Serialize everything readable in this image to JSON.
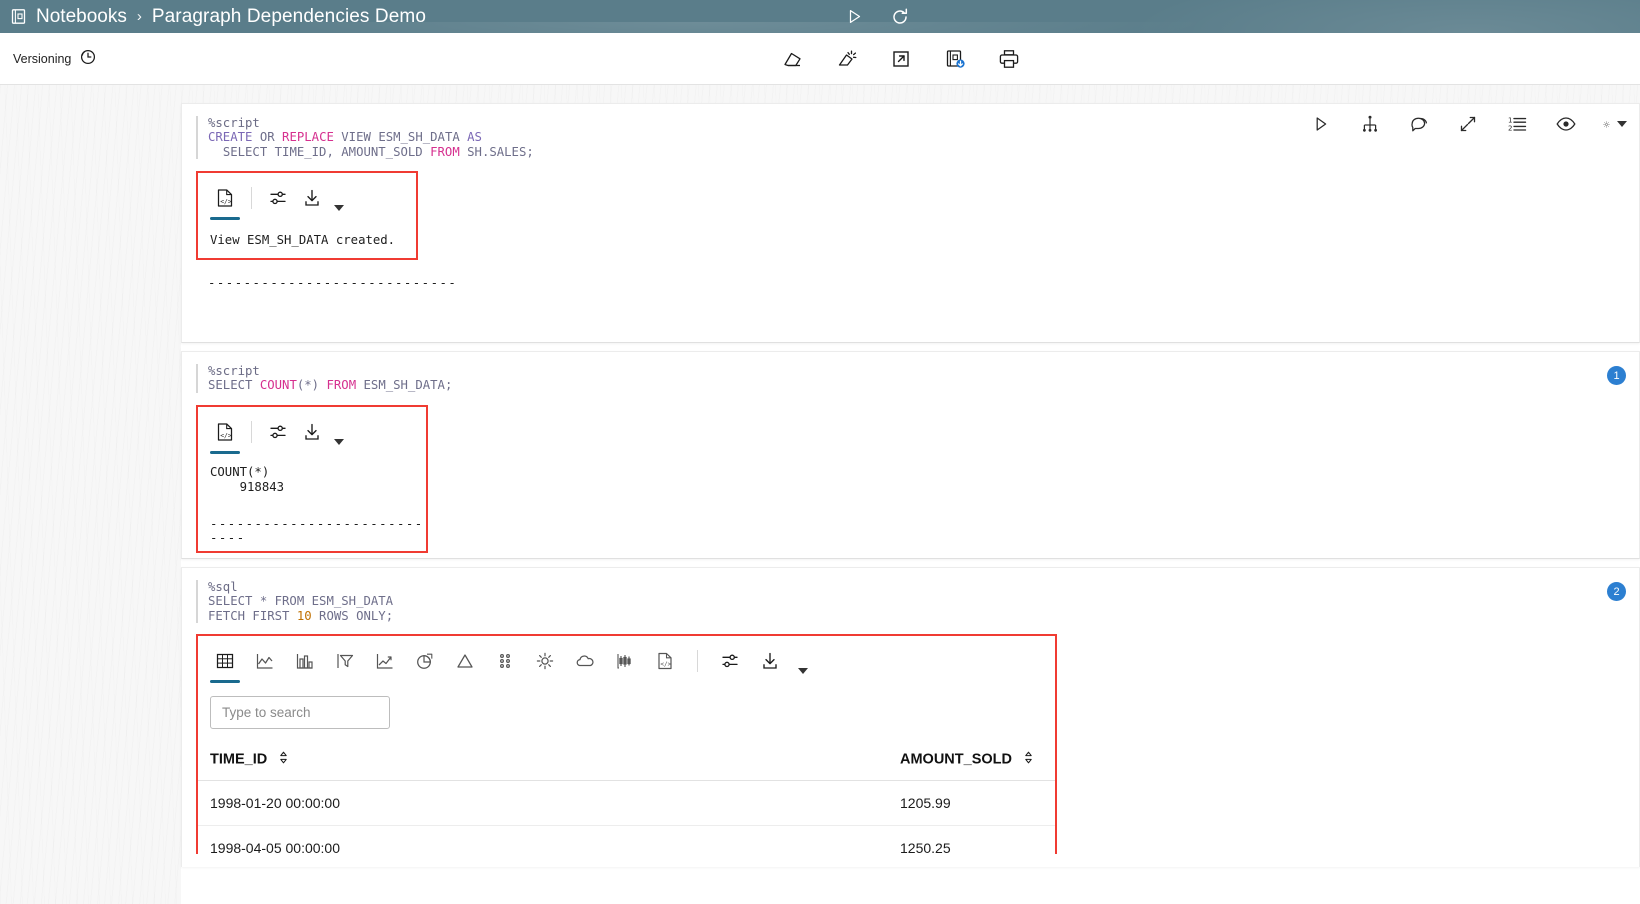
{
  "header": {
    "notebooks_label": "Notebooks",
    "separator": "›",
    "title": "Paragraph Dependencies Demo",
    "book_icon": "notebook-icon",
    "run_all_icon": "play-icon",
    "reset_icon": "refresh-icon"
  },
  "toolbar": {
    "versioning_label": "Versioning",
    "versioning_icon": "clock-history-icon",
    "actions": [
      {
        "name": "clear-results-icon",
        "title": "Clear Results"
      },
      {
        "name": "clear-all-output-icon",
        "title": "Clear All Output"
      },
      {
        "name": "external-link-icon",
        "title": "Open in New Window"
      },
      {
        "name": "save-notebook-icon",
        "title": "Save Notebook"
      },
      {
        "name": "print-icon",
        "title": "Print"
      }
    ]
  },
  "paragraph_actions": [
    {
      "name": "run-paragraph-icon",
      "title": "Run"
    },
    {
      "name": "dependency-graph-icon",
      "title": "Dependencies"
    },
    {
      "name": "comment-icon",
      "title": "Comment"
    },
    {
      "name": "expand-icon",
      "title": "Expand"
    },
    {
      "name": "line-numbers-icon",
      "title": "Line Numbers"
    },
    {
      "name": "visibility-icon",
      "title": "Show / Hide"
    },
    {
      "name": "settings-gear-icon",
      "title": "Settings"
    }
  ],
  "paragraphs": [
    {
      "id": "p1",
      "badge": "",
      "interpreter": "%script",
      "code_lines": [
        [
          {
            "t": "CREATE",
            "c": "kw-blue"
          },
          {
            "t": " OR ",
            "c": "kw-gray"
          },
          {
            "t": "REPLACE",
            "c": "kw-pink"
          },
          {
            "t": " VIEW ",
            "c": "kw-gray"
          },
          {
            "t": "ESM_SH_DATA",
            "c": "kw-gray"
          },
          {
            "t": " AS",
            "c": "kw-blue"
          }
        ],
        [
          {
            "t": "  SELECT",
            "c": "kw-gray"
          },
          {
            "t": " TIME_ID, AMOUNT_SOLD ",
            "c": "kw-gray"
          },
          {
            "t": "FROM",
            "c": "kw-pink"
          },
          {
            "t": " SH.SALES;",
            "c": "kw-gray"
          }
        ]
      ],
      "result_tabs": [
        {
          "name": "result-raw-tab",
          "icon": "code-document-icon",
          "active": true
        }
      ],
      "result_tools": [
        {
          "name": "result-settings-icon",
          "icon": "sliders-icon"
        },
        {
          "name": "result-download-icon",
          "icon": "download-icon"
        }
      ],
      "output_text": "View ESM_SH_DATA created.",
      "trailing_dashes": "----------------------------"
    },
    {
      "id": "p2",
      "badge": "1",
      "interpreter": "%script",
      "code_lines": [
        [
          {
            "t": "SELECT ",
            "c": "kw-gray"
          },
          {
            "t": "COUNT",
            "c": "kw-pink"
          },
          {
            "t": "(*) ",
            "c": "kw-gray"
          },
          {
            "t": "FROM",
            "c": "kw-pink"
          },
          {
            "t": " ESM_SH_DATA;",
            "c": "kw-gray"
          }
        ]
      ],
      "result_tabs": [
        {
          "name": "result-raw-tab",
          "icon": "code-document-icon",
          "active": true
        }
      ],
      "result_tools": [
        {
          "name": "result-settings-icon",
          "icon": "sliders-icon"
        },
        {
          "name": "result-download-icon",
          "icon": "download-icon"
        }
      ],
      "output_text": "COUNT(*)\n    918843",
      "trailing_dashes": "----------------------------"
    },
    {
      "id": "p3",
      "badge": "2",
      "interpreter": "%sql",
      "code_lines": [
        [
          {
            "t": "SELECT ",
            "c": "kw-gray"
          },
          {
            "t": "*",
            "c": "kw-gray"
          },
          {
            "t": " FROM ",
            "c": "kw-gray"
          },
          {
            "t": "ESM_SH_DATA",
            "c": "kw-gray"
          }
        ],
        [
          {
            "t": "FETCH FIRST ",
            "c": "kw-gray"
          },
          {
            "t": "10",
            "c": "kw-orange"
          },
          {
            "t": " ROWS ONLY;",
            "c": "kw-gray"
          }
        ]
      ],
      "chart_tabs": [
        {
          "name": "viz-table-tab",
          "icon": "table-grid-icon",
          "active": true
        },
        {
          "name": "viz-area-tab",
          "icon": "area-chart-icon",
          "active": false
        },
        {
          "name": "viz-bar-tab",
          "icon": "bar-chart-icon",
          "active": false
        },
        {
          "name": "viz-funnel-tab",
          "icon": "funnel-chart-icon",
          "active": false
        },
        {
          "name": "viz-line-tab",
          "icon": "line-trend-icon",
          "active": false
        },
        {
          "name": "viz-pie-tab",
          "icon": "pie-chart-icon",
          "active": false
        },
        {
          "name": "viz-pyramid-tab",
          "icon": "triangle-pyramid-icon",
          "active": false
        },
        {
          "name": "viz-scatter-tab",
          "icon": "scatter-dots-icon",
          "active": false
        },
        {
          "name": "viz-radial-tab",
          "icon": "sunburst-icon",
          "active": false
        },
        {
          "name": "viz-cloud-tab",
          "icon": "cloud-chart-icon",
          "active": false
        },
        {
          "name": "viz-candlestick-tab",
          "icon": "candlestick-icon",
          "active": false
        },
        {
          "name": "viz-raw-tab",
          "icon": "code-document-icon",
          "active": false
        }
      ],
      "result_tools": [
        {
          "name": "result-settings-icon",
          "icon": "sliders-icon"
        },
        {
          "name": "result-download-icon",
          "icon": "download-icon"
        }
      ],
      "search_placeholder": "Type to search",
      "search_value": "",
      "table": {
        "columns": [
          "TIME_ID",
          "AMOUNT_SOLD"
        ],
        "rows": [
          [
            "1998-01-20 00:00:00",
            "1205.99"
          ],
          [
            "1998-04-05 00:00:00",
            "1250.25"
          ]
        ]
      }
    }
  ],
  "colors": {
    "header_bg": "#5a7d8a",
    "accent": "#1a6a8e",
    "badge": "#2c7fd1",
    "annotation": "#f03b32"
  }
}
